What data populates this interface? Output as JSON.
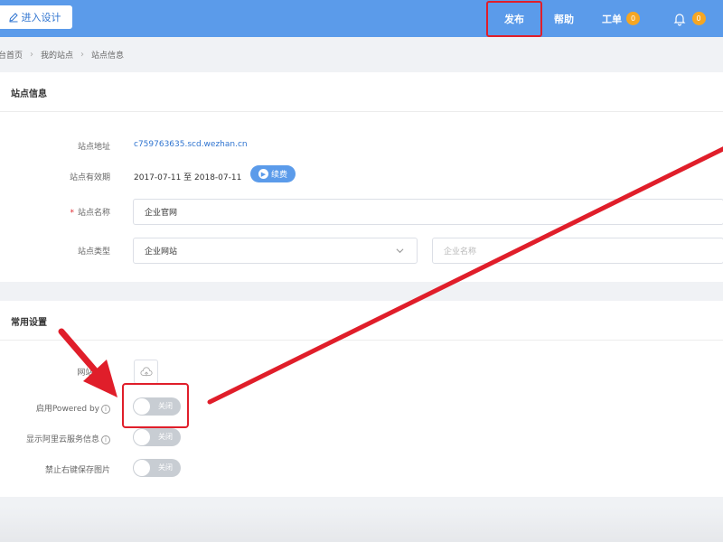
{
  "header": {
    "design_button": "进入设计",
    "nav": {
      "publish": "发布",
      "help": "帮助",
      "ticket": "工单",
      "ticket_badge": "0",
      "notify_badge": "0"
    }
  },
  "breadcrumb": [
    "台首页",
    "我的站点",
    "站点信息"
  ],
  "site_info": {
    "title": "站点信息",
    "address_label": "站点地址",
    "address_value": "c759763635.scd.wezhan.cn",
    "validity_label": "站点有效期",
    "validity_value": "2017-07-11 至 2018-07-11",
    "renew_button": "续费",
    "name_label": "站点名称",
    "name_value": "企业官网",
    "type_label": "站点类型",
    "type_value": "企业网站",
    "company_placeholder": "企业名称"
  },
  "common_settings": {
    "title": "常用设置",
    "favicon_label": "网站icon",
    "powered_by_label": "启用Powered by",
    "aliyun_label": "显示阿里云服务信息",
    "right_click_label": "禁止右键保存图片",
    "toggle_off_text": "关闭",
    "toggles": {
      "powered_by": false,
      "aliyun": false,
      "right_click": false
    }
  },
  "colors": {
    "header": "#5b9bea",
    "link": "#2f74d0",
    "annotation": "#e01e2a",
    "badge": "#f5a623"
  }
}
